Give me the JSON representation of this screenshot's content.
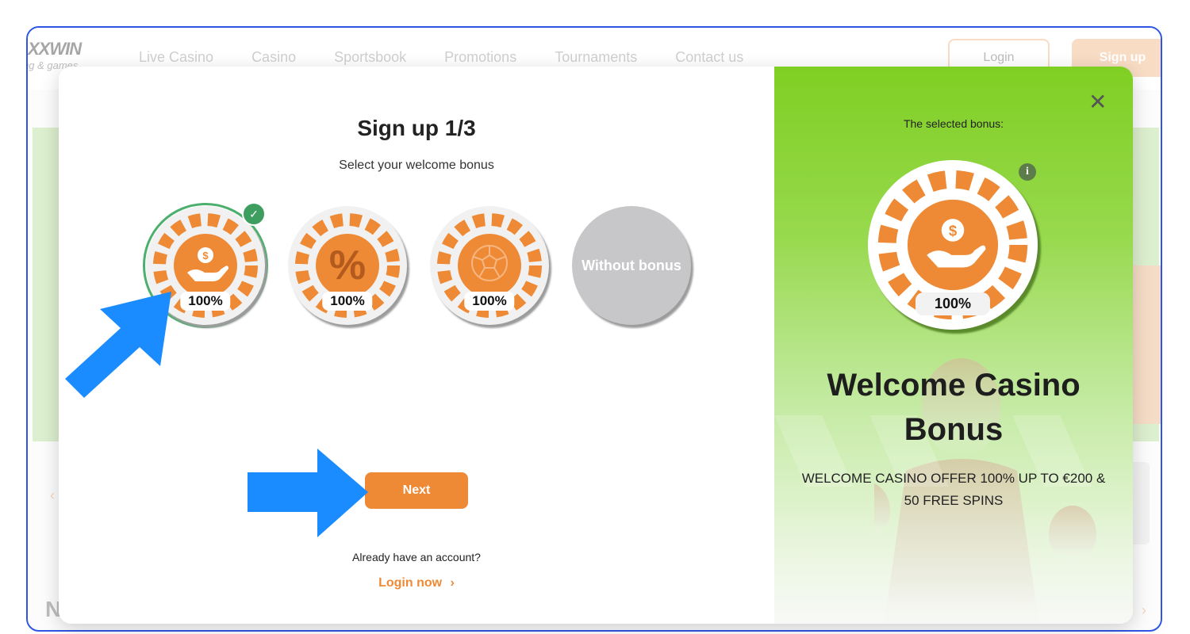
{
  "site": {
    "logo": "XXWIN",
    "logo_sub": "ng & games",
    "nav": [
      "Live Casino",
      "Casino",
      "Sportsbook",
      "Promotions",
      "Tournaments",
      "Contact us"
    ],
    "login_label": "Login",
    "signup_label": "Sign up",
    "bottom_letter": "N"
  },
  "modal": {
    "title": "Sign up 1/3",
    "subtitle": "Select your welcome bonus",
    "options": [
      {
        "badge": "100%",
        "icon": "money-hand-icon",
        "selected": true
      },
      {
        "badge": "100%",
        "icon": "percent-icon",
        "selected": false
      },
      {
        "badge": "100%",
        "icon": "football-icon",
        "selected": false
      }
    ],
    "without_label": "Without bonus",
    "next_label": "Next",
    "already_text": "Already have an account?",
    "login_now_label": "Login now",
    "login_now_chevron": "›"
  },
  "side": {
    "close_glyph": "✕",
    "selected_label": "The selected bonus:",
    "info_glyph": "i",
    "badge": "100%",
    "heading": "Welcome Casino Bonus",
    "offer": "WELCOME CASINO OFFER 100% UP TO €200 & 50 FREE SPINS"
  },
  "colors": {
    "accent": "#ee8a35",
    "selected_ring": "#4caf6d",
    "panel_green": "#7fcf23",
    "annotation_arrow": "#1a8cff"
  }
}
